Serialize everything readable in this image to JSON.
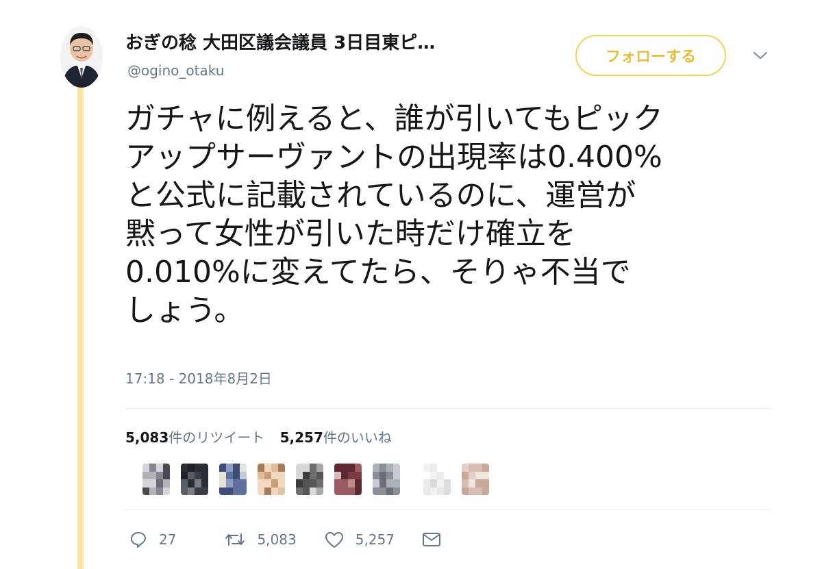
{
  "user": {
    "display_name": "おぎの稔 大田区議会議員 3日目東ピ…",
    "handle": "@ogino_otaku",
    "follow_label": "フォローする"
  },
  "tweet": {
    "lines": [
      "ガチャに例えると、誰が引いてもピック",
      "アップサーヴァントの出現率は0.400%",
      "と公式に記載されているのに、運営が",
      "黙って女性が引いた時だけ確立を",
      "0.010%に変えてたら、そりゃ不当で",
      "しょう。"
    ],
    "timestamp": "17:18 - 2018年8月2日"
  },
  "stats": {
    "retweets_count": "5,083",
    "retweets_label": "件のリツイート",
    "likes_count": "5,257",
    "likes_label": "件のいいね"
  },
  "actions": {
    "reply_count": "27",
    "retweet_count": "5,083",
    "like_count": "5,257"
  },
  "colors": {
    "accent_yellow": "#f1d35c",
    "thread_line": "#fbe7a0",
    "muted_text": "#657786"
  },
  "icons": {
    "caret": "chevron-down-icon",
    "reply": "reply-icon",
    "retweet": "retweet-icon",
    "like": "heart-icon",
    "dm": "envelope-icon"
  }
}
